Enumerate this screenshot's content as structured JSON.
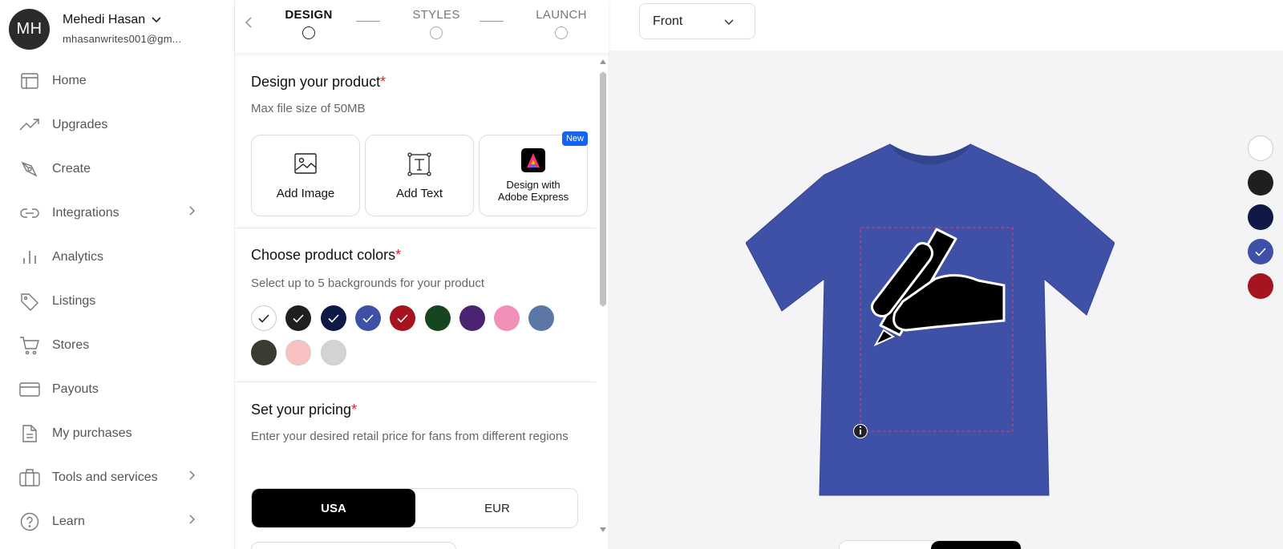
{
  "user": {
    "initials": "MH",
    "name": "Mehedi Hasan",
    "email": "mhasanwrites001@gm..."
  },
  "nav": [
    {
      "label": "Home",
      "icon": "layout-icon"
    },
    {
      "label": "Upgrades",
      "icon": "trend-icon"
    },
    {
      "label": "Create",
      "icon": "pen-tool-icon"
    },
    {
      "label": "Integrations",
      "icon": "link-icon",
      "chevron": true
    },
    {
      "label": "Analytics",
      "icon": "bar-chart-icon"
    },
    {
      "label": "Listings",
      "icon": "tag-icon"
    },
    {
      "label": "Stores",
      "icon": "cart-icon"
    },
    {
      "label": "Payouts",
      "icon": "credit-card-icon"
    },
    {
      "label": "My purchases",
      "icon": "document-icon"
    },
    {
      "label": "Tools and services",
      "icon": "briefcase-icon",
      "chevron": true
    },
    {
      "label": "Learn",
      "icon": "help-circle-icon",
      "chevron": true
    }
  ],
  "stepper": {
    "steps": [
      "DESIGN",
      "STYLES",
      "LAUNCH"
    ],
    "active": 0
  },
  "design": {
    "title": "Design your product",
    "required": "*",
    "subtitle": "Max file size of 50MB",
    "tools": [
      {
        "label": "Add Image",
        "icon": "image-icon"
      },
      {
        "label": "Add Text",
        "icon": "text-box-icon"
      },
      {
        "label_line1": "Design with",
        "label_line2": "Adobe Express",
        "badge": "New",
        "icon": "adobe-express-icon"
      }
    ]
  },
  "colors": {
    "title": "Choose product colors",
    "required": "*",
    "subtitle": "Select up to 5 backgrounds for your product",
    "swatches": [
      {
        "hex": "#ffffff",
        "selected": true
      },
      {
        "hex": "#1f1f1f",
        "selected": true
      },
      {
        "hex": "#0e1a45",
        "selected": true
      },
      {
        "hex": "#3f51a6",
        "selected": true
      },
      {
        "hex": "#a5141f",
        "selected": true
      },
      {
        "hex": "#15461f",
        "selected": false
      },
      {
        "hex": "#4a2372",
        "selected": false
      },
      {
        "hex": "#f08fb7",
        "selected": false
      },
      {
        "hex": "#5b77a6",
        "selected": false
      },
      {
        "hex": "#3b3a33",
        "selected": false
      },
      {
        "hex": "#f8c2c2",
        "selected": false
      },
      {
        "hex": "#d3d3d3",
        "selected": false
      }
    ]
  },
  "pricing": {
    "title": "Set your pricing",
    "required": "*",
    "subtitle": "Enter your desired retail price for fans from different regions",
    "currencies": [
      "USA",
      "EUR"
    ],
    "active": 0
  },
  "preview": {
    "view": "Front",
    "shirt_color": "#3f51a6",
    "side_swatches": [
      {
        "hex": "#ffffff",
        "selected": false
      },
      {
        "hex": "#1f1f1f",
        "selected": false
      },
      {
        "hex": "#0e1a45",
        "selected": false
      },
      {
        "hex": "#3f51a6",
        "selected": true
      },
      {
        "hex": "#a5141f",
        "selected": false
      }
    ]
  }
}
